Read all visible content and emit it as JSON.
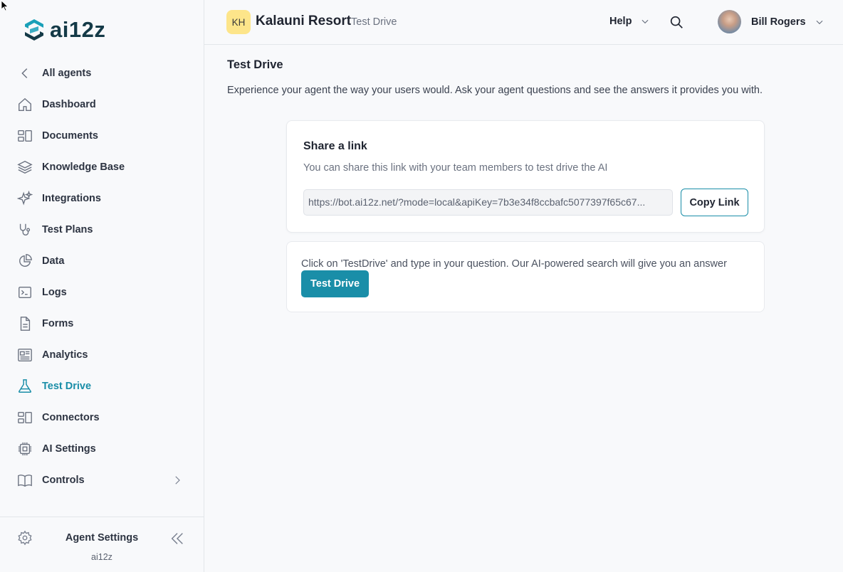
{
  "brand": {
    "logo_text": "ai12z",
    "accent": "#1a8ea8"
  },
  "sidebar": {
    "back_label": "All agents",
    "items": [
      {
        "label": "Dashboard",
        "icon": "home-icon"
      },
      {
        "label": "Documents",
        "icon": "documents-icon"
      },
      {
        "label": "Knowledge Base",
        "icon": "layers-icon"
      },
      {
        "label": "Integrations",
        "icon": "sparkles-icon"
      },
      {
        "label": "Test Plans",
        "icon": "stethoscope-icon"
      },
      {
        "label": "Data",
        "icon": "pie-chart-icon"
      },
      {
        "label": "Logs",
        "icon": "terminal-icon"
      },
      {
        "label": "Forms",
        "icon": "file-icon"
      },
      {
        "label": "Analytics",
        "icon": "newspaper-icon"
      },
      {
        "label": "Test Drive",
        "icon": "flask-icon",
        "active": true
      },
      {
        "label": "Connectors",
        "icon": "connectors-icon"
      },
      {
        "label": "AI Settings",
        "icon": "cpu-icon"
      },
      {
        "label": "Controls",
        "icon": "book-icon"
      }
    ],
    "footer": {
      "title": "Agent Settings",
      "sub": "ai12z"
    }
  },
  "header": {
    "badge": "KH",
    "org_name": "Kalauni Resort",
    "org_sub": "Test Drive",
    "help_label": "Help",
    "user_name": "Bill Rogers"
  },
  "main": {
    "title": "Test Drive",
    "description": "Experience your agent the way your users would. Ask your agent questions and see the answers it provides you with.",
    "share": {
      "title": "Share a link",
      "sub": "You can share this link with your team members to test drive the AI",
      "link": "https://bot.ai12z.net/?mode=local&apiKey=7b3e34f8ccbafc5077397f65c67...",
      "copy_label": "Copy Link"
    },
    "testdrive": {
      "text": "Click on 'TestDrive' and type in your question. Our AI-powered search will give you an answer",
      "button_label": "Test Drive"
    }
  }
}
